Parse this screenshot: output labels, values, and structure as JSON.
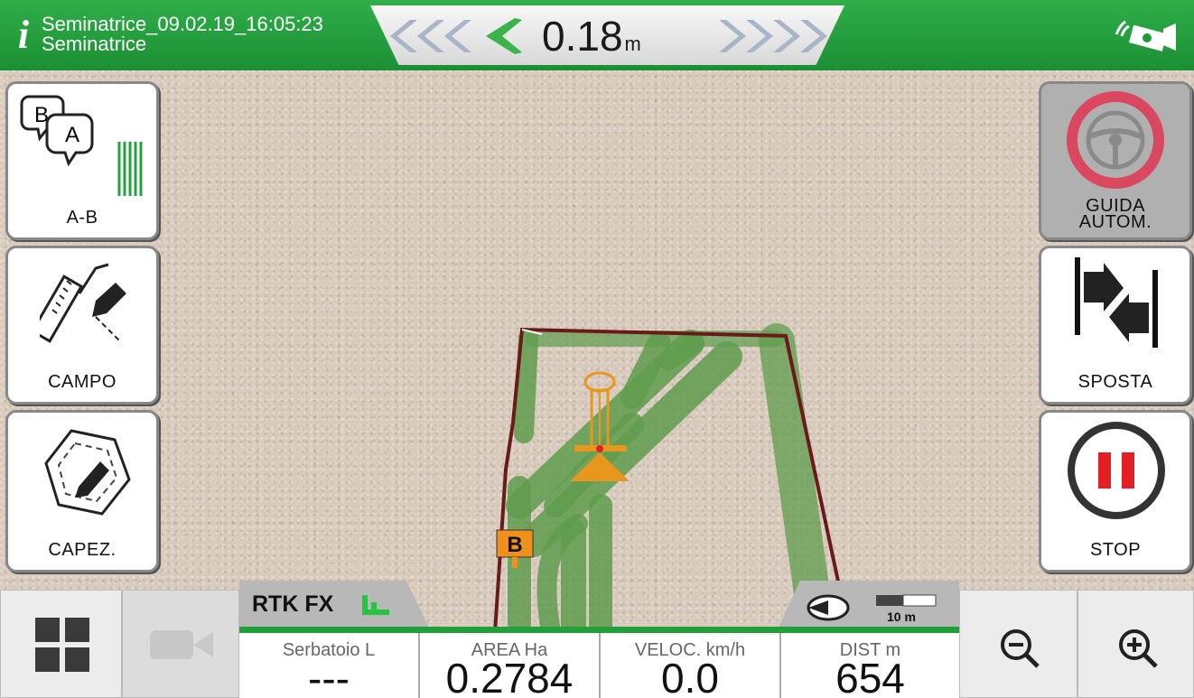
{
  "header": {
    "title_line1": "Seminatrice_09.02.19_16:05:23",
    "title_line2": "Seminatrice",
    "crosstrack_value": "0.18",
    "crosstrack_unit": "m"
  },
  "left_buttons": [
    {
      "label": "A-B",
      "icon": "ab-line-icon"
    },
    {
      "label": "CAMPO",
      "icon": "field-boundary-pencil-icon"
    },
    {
      "label": "CAPEZ.",
      "icon": "headland-pencil-icon"
    }
  ],
  "right_buttons": [
    {
      "label_line1": "GUIDA",
      "label_line2": "AUTOM.",
      "icon": "steering-wheel-icon"
    },
    {
      "label": "SPOSTA",
      "icon": "shift-line-icon"
    },
    {
      "label": "STOP",
      "icon": "pause-icon"
    }
  ],
  "map": {
    "marker_b": "B",
    "rtk_status": "RTK FX",
    "scale_label": "10 m"
  },
  "readouts": [
    {
      "caption": "Serbatoio L",
      "value": "---"
    },
    {
      "caption": "AREA Ha",
      "value": "0.2784"
    },
    {
      "caption": "VELOC. km/h",
      "value": "0.0"
    },
    {
      "caption": "DIST m",
      "value": "654"
    }
  ],
  "colors": {
    "brand_green": "#1c9a38",
    "coverage_green": "#5f9c4e",
    "boundary": "#6b1a1a",
    "stop_red": "#e41f24",
    "steer_ring": "#d9485e",
    "vehicle_orange": "#e8961c"
  }
}
